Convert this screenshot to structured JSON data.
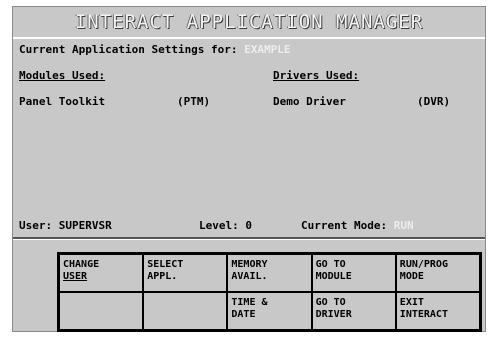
{
  "window": {
    "title": "INTERACT APPLICATION MANAGER"
  },
  "settings": {
    "current_app_label": "Current Application Settings for:",
    "current_app_value": "EXAMPLE",
    "modules_header": "Modules Used:",
    "drivers_header": "Drivers Used:",
    "module_name": "Panel Toolkit",
    "module_code": "(PTM)",
    "driver_name": "Demo Driver",
    "driver_code": "(DVR)"
  },
  "status": {
    "user_label": "User:",
    "user_value": "SUPERVSR",
    "level_label": "Level:",
    "level_value": "0",
    "mode_label": "Current Mode:",
    "mode_value": "RUN"
  },
  "function_keys": [
    {
      "line1": "CHANGE",
      "line2": "USER"
    },
    {
      "line1": "SELECT",
      "line2": "APPL."
    },
    {
      "line1": "MEMORY",
      "line2": "AVAIL."
    },
    {
      "line1": "GO TO",
      "line2": "MODULE"
    },
    {
      "line1": "RUN/PROG",
      "line2": "MODE"
    },
    {
      "line1": "",
      "line2": ""
    },
    {
      "line1": "",
      "line2": ""
    },
    {
      "line1": "TIME &",
      "line2": "DATE"
    },
    {
      "line1": "GO TO",
      "line2": "DRIVER"
    },
    {
      "line1": "EXIT",
      "line2": "INTERACT"
    }
  ],
  "colors": {
    "window_bg": "#c8c8c8",
    "dim_text": "#ededed"
  }
}
